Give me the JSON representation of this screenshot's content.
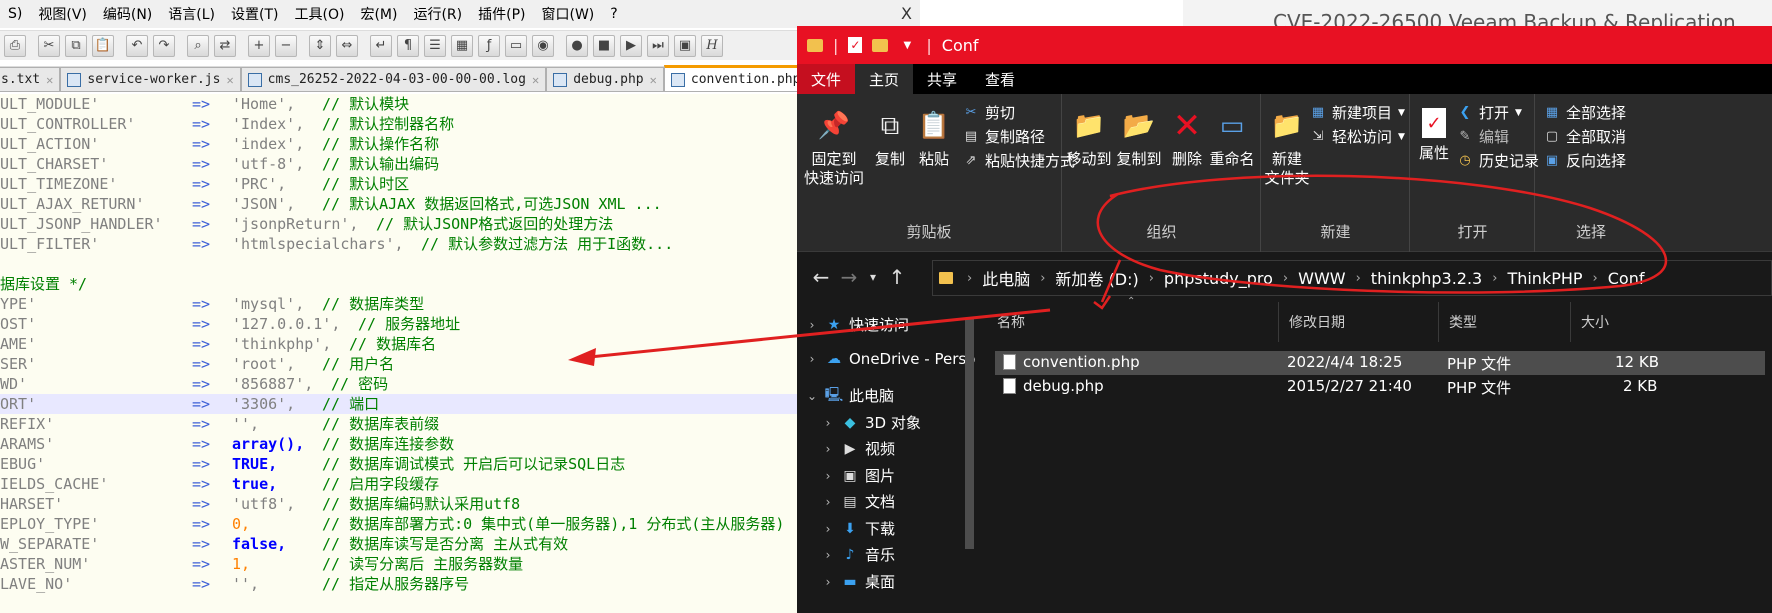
{
  "editor": {
    "menu": [
      "S)",
      "视图(V)",
      "编码(N)",
      "语言(L)",
      "设置(T)",
      "工具(O)",
      "宏(M)",
      "运行(R)",
      "插件(P)",
      "窗口(W)",
      "?"
    ],
    "close_glyph": "X",
    "tabs": [
      {
        "label": "s.txt"
      },
      {
        "label": "service-worker.js"
      },
      {
        "label": "cms_26252-2022-04-03-00-00-00.log"
      },
      {
        "label": "debug.php"
      },
      {
        "label": "convention.php"
      }
    ],
    "code_lines": [
      {
        "key": "ULT_MODULE'",
        "arrow": "=>",
        "val": "'Home',",
        "comment": "// 默认模块"
      },
      {
        "key": "ULT_CONTROLLER'",
        "arrow": "=>",
        "val": "'Index',",
        "comment": "// 默认控制器名称"
      },
      {
        "key": "ULT_ACTION'",
        "arrow": "=>",
        "val": "'index',",
        "comment": "// 默认操作名称"
      },
      {
        "key": "ULT_CHARSET'",
        "arrow": "=>",
        "val": "'utf-8',",
        "comment": "// 默认输出编码"
      },
      {
        "key": "ULT_TIMEZONE'",
        "arrow": "=>",
        "val": "'PRC',",
        "comment": "// 默认时区"
      },
      {
        "key": "ULT_AJAX_RETURN'",
        "arrow": "=>",
        "val": "'JSON',",
        "comment": "// 默认AJAX 数据返回格式,可选JSON XML ..."
      },
      {
        "key": "ULT_JSONP_HANDLER'",
        "arrow": "=>",
        "val": "'jsonpReturn',",
        "comment": "// 默认JSONP格式返回的处理方法"
      },
      {
        "key": "ULT_FILTER'",
        "arrow": "=>",
        "val": "'htmlspecialchars',",
        "comment": "// 默认参数过滤方法 用于I函数..."
      },
      {
        "key": "",
        "arrow": "",
        "val": "",
        "comment": ""
      },
      {
        "section": "据库设置 */"
      },
      {
        "key": "YPE'",
        "arrow": "=>",
        "val": "'mysql',",
        "comment": "// 数据库类型"
      },
      {
        "key": "OST'",
        "arrow": "=>",
        "val": "'127.0.0.1',",
        "comment": "// 服务器地址"
      },
      {
        "key": "AME'",
        "arrow": "=>",
        "val": "'thinkphp',",
        "comment": "// 数据库名"
      },
      {
        "key": "SER'",
        "arrow": "=>",
        "val": "'root',",
        "comment": "// 用户名"
      },
      {
        "key": "WD'",
        "arrow": "=>",
        "val": "'856887',",
        "comment": "// 密码"
      },
      {
        "key": "ORT'",
        "arrow": "=>",
        "val": "'3306',",
        "comment": "// 端口"
      },
      {
        "key": "REFIX'",
        "arrow": "=>",
        "val": "'',",
        "comment": "// 数据库表前缀"
      },
      {
        "key": "ARAMS'",
        "arrow": "=>",
        "val": "array(),",
        "comment": "// 数据库连接参数"
      },
      {
        "key": "EBUG'",
        "arrow": "=>",
        "val": "TRUE,",
        "comment": "// 数据库调试模式 开启后可以记录SQL日志"
      },
      {
        "key": "IELDS_CACHE'",
        "arrow": "=>",
        "val": "true,",
        "comment": "// 启用字段缓存"
      },
      {
        "key": "HARSET'",
        "arrow": "=>",
        "val": "'utf8',",
        "comment": "// 数据库编码默认采用utf8"
      },
      {
        "key": "EPLOY_TYPE'",
        "arrow": "=>",
        "val": "0,",
        "comment": "// 数据库部署方式:0 集中式(单一服务器),1 分布式(主从服务器)"
      },
      {
        "key": "W_SEPARATE'",
        "arrow": "=>",
        "val": "false,",
        "comment": "// 数据库读写是否分离 主从式有效"
      },
      {
        "key": "ASTER_NUM'",
        "arrow": "=>",
        "val": "1,",
        "comment": "// 读写分离后 主服务器数量"
      },
      {
        "key": "LAVE_NO'",
        "arrow": "=>",
        "val": "'',",
        "comment": "// 指定从服务器序号"
      }
    ]
  },
  "explorer": {
    "title": "Conf",
    "ribbon_tabs": [
      "文件",
      "主页",
      "共享",
      "查看"
    ],
    "groups": {
      "clipboard": {
        "label": "剪贴板",
        "pin": "固定到\n快速访问",
        "copy": "复制",
        "paste": "粘贴",
        "cut": "剪切",
        "copy_path": "复制路径",
        "paste_shortcut": "粘贴快捷方式"
      },
      "organize": {
        "label": "组织",
        "move_to": "移动到",
        "copy_to": "复制到",
        "delete": "删除",
        "rename": "重命名"
      },
      "new": {
        "label": "新建",
        "new_folder": "新建\n文件夹",
        "new_item": "新建项目",
        "easy_access": "轻松访问"
      },
      "open": {
        "label": "打开",
        "properties": "属性",
        "open": "打开",
        "edit": "编辑",
        "history": "历史记录"
      },
      "select": {
        "label": "选择",
        "select_all": "全部选择",
        "select_none": "全部取消",
        "invert": "反向选择"
      }
    },
    "breadcrumb": [
      "此电脑",
      "新加卷 (D:)",
      "phpstudy_pro",
      "WWW",
      "thinkphp3.2.3",
      "ThinkPHP",
      "Conf"
    ],
    "nav": [
      {
        "label": "快速访问",
        "icon": "star-icon"
      },
      {
        "label": "OneDrive - Perso",
        "icon": "cloud-icon"
      },
      {
        "label": "此电脑",
        "icon": "pc-icon"
      },
      {
        "label": "3D 对象",
        "icon": "cube-icon"
      },
      {
        "label": "视频",
        "icon": "video-icon"
      },
      {
        "label": "图片",
        "icon": "picture-icon"
      },
      {
        "label": "文档",
        "icon": "document-icon"
      },
      {
        "label": "下载",
        "icon": "download-icon"
      },
      {
        "label": "音乐",
        "icon": "music-icon"
      },
      {
        "label": "桌面",
        "icon": "desktop-icon"
      }
    ],
    "columns": [
      "名称",
      "修改日期",
      "类型",
      "大小"
    ],
    "files": [
      {
        "name": "convention.php",
        "date": "2022/4/4 18:25",
        "type": "PHP 文件",
        "size": "12 KB",
        "selected": true
      },
      {
        "name": "debug.php",
        "date": "2015/2/27 21:40",
        "type": "PHP 文件",
        "size": "2 KB",
        "selected": false
      }
    ]
  },
  "background_page": {
    "title": "CVE-2022-26500 Veeam Backup & Replication"
  },
  "colors": {
    "title_bar": "#e81123",
    "annotation": "#e02020",
    "editor_bg": "#fdfdf1",
    "explorer_bg": "#191919"
  }
}
